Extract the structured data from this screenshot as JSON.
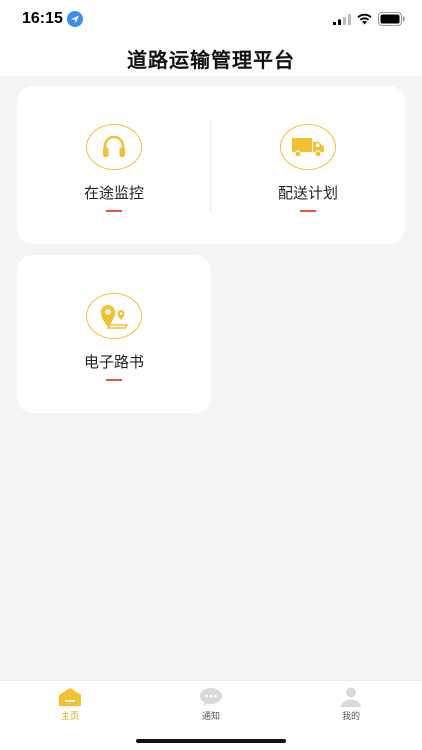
{
  "status_bar": {
    "time": "16:15",
    "location_icon": "location-arrow-icon",
    "signal_icon": "cellular-signal-icon",
    "wifi_icon": "wifi-icon",
    "battery_icon": "battery-icon"
  },
  "header": {
    "title": "道路运输管理平台"
  },
  "menu": {
    "items": [
      {
        "label": "在途监控",
        "icon": "headphones-icon"
      },
      {
        "label": "配送计划",
        "icon": "delivery-truck-icon"
      },
      {
        "label": "电子路书",
        "icon": "map-location-icon"
      }
    ]
  },
  "tabbar": {
    "tabs": [
      {
        "label": "主页",
        "icon": "home-icon",
        "active": true
      },
      {
        "label": "通知",
        "icon": "chat-bubble-icon",
        "active": false
      },
      {
        "label": "我的",
        "icon": "user-profile-icon",
        "active": false
      }
    ]
  },
  "colors": {
    "accent": "#f2c12e",
    "underline": "#e8553a",
    "active_tab": "#e0a21c",
    "inactive_icon": "#d9d9d9"
  }
}
